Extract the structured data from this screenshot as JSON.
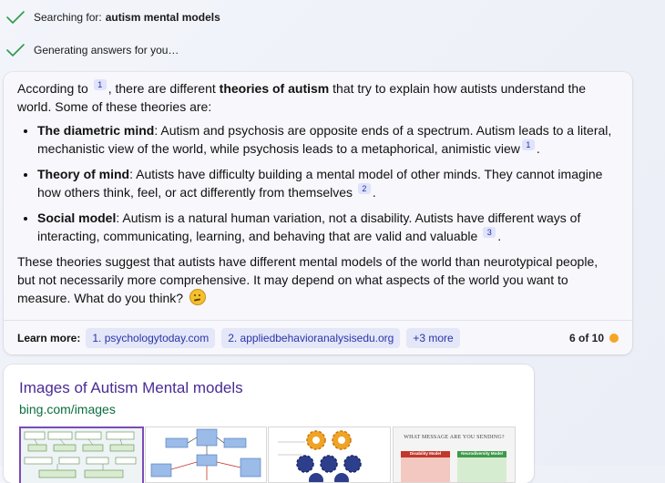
{
  "progress": {
    "searching_prefix": "Searching for:",
    "searching_query": "autism mental models",
    "generating": "Generating answers for you…"
  },
  "answer": {
    "intro_a": "According to",
    "intro_cite": "1",
    "intro_b": ", there are different",
    "intro_bold": "theories of autism",
    "intro_c": "that try to explain how autists understand the world. Some of these theories are:",
    "bullets": [
      {
        "title": "The diametric mind",
        "text": ": Autism and psychosis are opposite ends of a spectrum. Autism leads to a literal, mechanistic view of the world, while psychosis leads to a metaphorical, animistic view",
        "cite": "1",
        "end": "."
      },
      {
        "title": "Theory of mind",
        "text": ": Autists have difficulty building a mental model of other minds. They cannot imagine how others think, feel, or act differently from themselves",
        "cite": "2",
        "end": "."
      },
      {
        "title": "Social model",
        "text": ": Autism is a natural human variation, not a disability. Autists have different ways of interacting, communicating, learning, and behaving that are valid and valuable",
        "cite": "3",
        "end": "."
      }
    ],
    "conclusion": "These theories suggest that autists have different mental models of the world than neurotypical people, but not necessarily more comprehensive. It may depend on what aspects of the world you want to measure. What do you think?"
  },
  "learn_more": {
    "label": "Learn more:",
    "sources": [
      "1. psychologytoday.com",
      "2. appliedbehavioranalysisedu.org",
      "+3 more"
    ],
    "counter": "6 of 10"
  },
  "images": {
    "title": "Images of Autism Mental models",
    "source": "bing.com/images",
    "thumb4_heading": "WHAT MESSAGE ARE YOU SENDING?",
    "thumb4_left": "Disability Model",
    "thumb4_right": "Neurodiversity Model"
  },
  "colors": {
    "check_green": "#2e9a4a",
    "citation_bg": "#dfe3fb",
    "link_purple": "#4b2c93",
    "source_green": "#0a6e3f",
    "status_dot": "#f5a623"
  },
  "icons": {
    "check": "check-icon",
    "emoji": "thinking-face-emoji",
    "status": "status-dot"
  }
}
